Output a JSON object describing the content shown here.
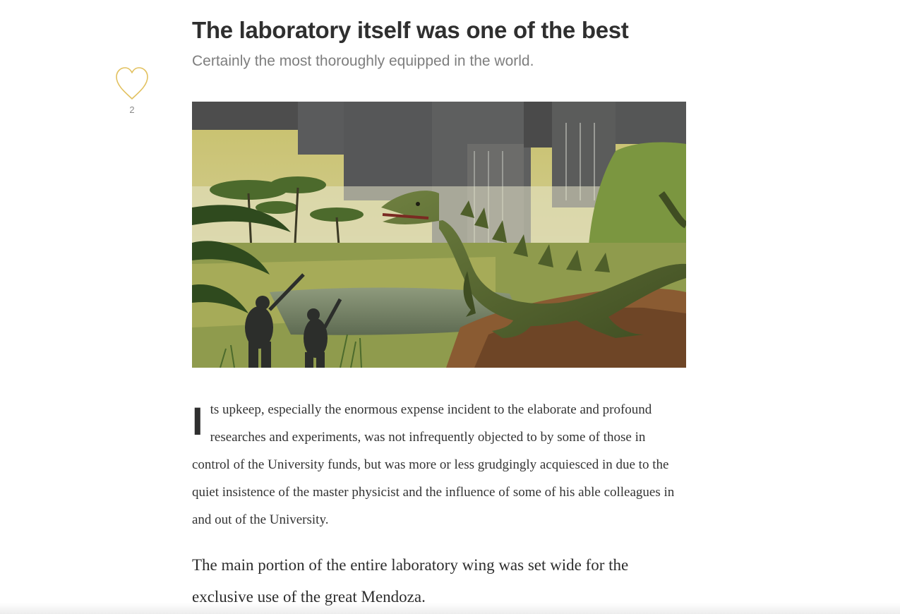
{
  "article": {
    "title": "The laboratory itself was one of the best",
    "subtitle": "Certainly the most thoroughly equipped in the world.",
    "like_count": "2",
    "drop_cap": "I",
    "lead_paragraph": "ts upkeep, especially the enormous expense incident to the elaborate and profound researches and experiments, was not infrequently objected to by some of those in control of the University funds, but was more or less grudgingly acquiesced in due to the quiet insistence of the master physicist and the influence of some of his able colleagues in and out of the University.",
    "paragraph_2": "The main portion of the entire laboratory wing was set wide for the exclusive use of the great Mendoza."
  },
  "icons": {
    "like": "heart-icon"
  },
  "colors": {
    "heart_outline": "#e2c15f",
    "title": "#2f2f2f",
    "subtitle": "#7e7e7e",
    "body_text": "#333333"
  }
}
